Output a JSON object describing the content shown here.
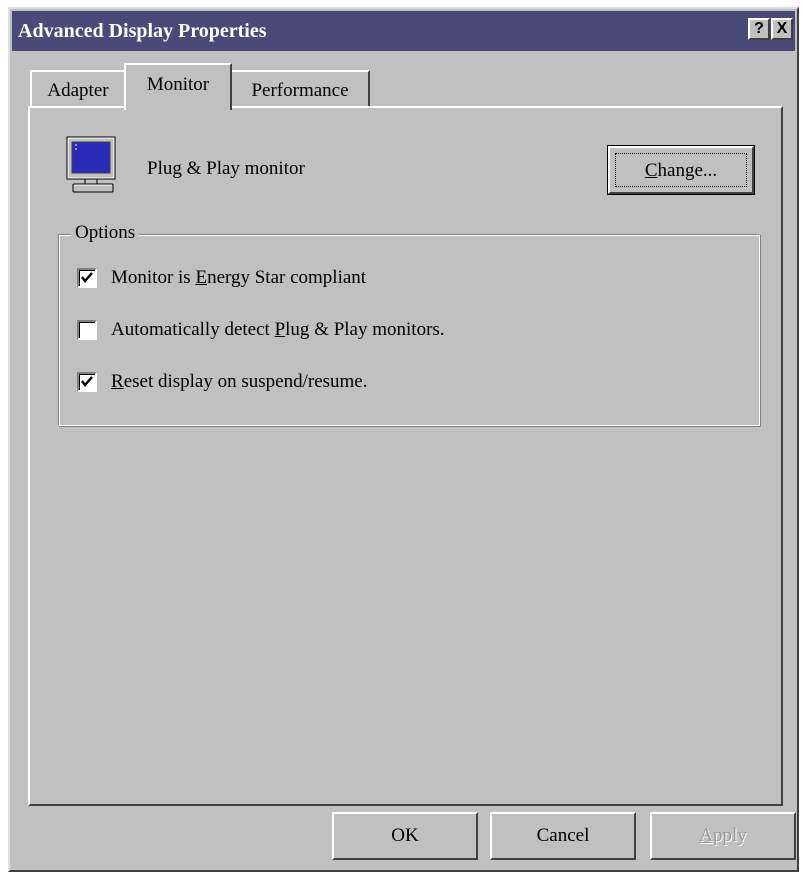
{
  "window": {
    "title": "Advanced Display Properties",
    "help_button": "?",
    "close_button": "X"
  },
  "tabs": [
    {
      "label": "Adapter",
      "active": false
    },
    {
      "label": "Monitor",
      "active": true
    },
    {
      "label": "Performance",
      "active": false
    }
  ],
  "monitor": {
    "icon": "monitor-icon",
    "label": "Plug & Play monitor",
    "change_button": {
      "before": "",
      "mnemonic": "C",
      "after": "hange..."
    }
  },
  "options": {
    "group_label": "Options",
    "items": [
      {
        "checked": true,
        "before": "Monitor is ",
        "mnemonic": "E",
        "after": "nergy Star compliant"
      },
      {
        "checked": false,
        "before": "Automatically detect ",
        "mnemonic": "P",
        "after": "lug & Play monitors."
      },
      {
        "checked": true,
        "before": "",
        "mnemonic": "R",
        "after": "eset display on suspend/resume."
      }
    ]
  },
  "buttons": {
    "ok": "OK",
    "cancel": "Cancel",
    "apply": {
      "before": "",
      "mnemonic": "A",
      "after": "pply",
      "enabled": false
    }
  },
  "colors": {
    "titlebar": "#4a4a78",
    "face": "#c0c0c0",
    "screen_blue": "#2a2ab8"
  }
}
